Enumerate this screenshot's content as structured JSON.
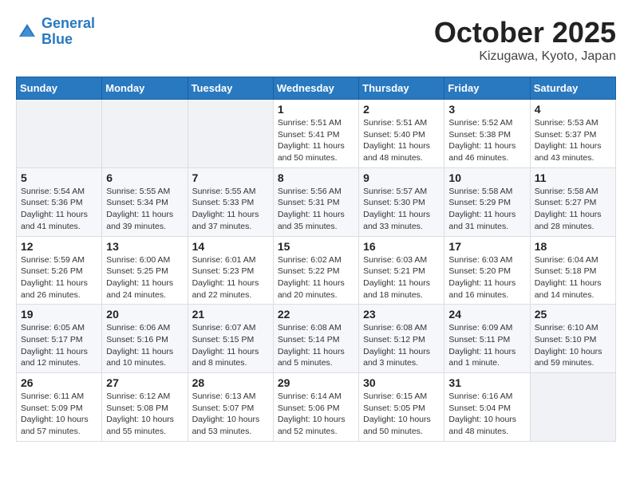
{
  "logo": {
    "line1": "General",
    "line2": "Blue"
  },
  "header": {
    "month": "October 2025",
    "location": "Kizugawa, Kyoto, Japan"
  },
  "weekdays": [
    "Sunday",
    "Monday",
    "Tuesday",
    "Wednesday",
    "Thursday",
    "Friday",
    "Saturday"
  ],
  "weeks": [
    [
      {
        "day": "",
        "info": ""
      },
      {
        "day": "",
        "info": ""
      },
      {
        "day": "",
        "info": ""
      },
      {
        "day": "1",
        "info": "Sunrise: 5:51 AM\nSunset: 5:41 PM\nDaylight: 11 hours\nand 50 minutes."
      },
      {
        "day": "2",
        "info": "Sunrise: 5:51 AM\nSunset: 5:40 PM\nDaylight: 11 hours\nand 48 minutes."
      },
      {
        "day": "3",
        "info": "Sunrise: 5:52 AM\nSunset: 5:38 PM\nDaylight: 11 hours\nand 46 minutes."
      },
      {
        "day": "4",
        "info": "Sunrise: 5:53 AM\nSunset: 5:37 PM\nDaylight: 11 hours\nand 43 minutes."
      }
    ],
    [
      {
        "day": "5",
        "info": "Sunrise: 5:54 AM\nSunset: 5:36 PM\nDaylight: 11 hours\nand 41 minutes."
      },
      {
        "day": "6",
        "info": "Sunrise: 5:55 AM\nSunset: 5:34 PM\nDaylight: 11 hours\nand 39 minutes."
      },
      {
        "day": "7",
        "info": "Sunrise: 5:55 AM\nSunset: 5:33 PM\nDaylight: 11 hours\nand 37 minutes."
      },
      {
        "day": "8",
        "info": "Sunrise: 5:56 AM\nSunset: 5:31 PM\nDaylight: 11 hours\nand 35 minutes."
      },
      {
        "day": "9",
        "info": "Sunrise: 5:57 AM\nSunset: 5:30 PM\nDaylight: 11 hours\nand 33 minutes."
      },
      {
        "day": "10",
        "info": "Sunrise: 5:58 AM\nSunset: 5:29 PM\nDaylight: 11 hours\nand 31 minutes."
      },
      {
        "day": "11",
        "info": "Sunrise: 5:58 AM\nSunset: 5:27 PM\nDaylight: 11 hours\nand 28 minutes."
      }
    ],
    [
      {
        "day": "12",
        "info": "Sunrise: 5:59 AM\nSunset: 5:26 PM\nDaylight: 11 hours\nand 26 minutes."
      },
      {
        "day": "13",
        "info": "Sunrise: 6:00 AM\nSunset: 5:25 PM\nDaylight: 11 hours\nand 24 minutes."
      },
      {
        "day": "14",
        "info": "Sunrise: 6:01 AM\nSunset: 5:23 PM\nDaylight: 11 hours\nand 22 minutes."
      },
      {
        "day": "15",
        "info": "Sunrise: 6:02 AM\nSunset: 5:22 PM\nDaylight: 11 hours\nand 20 minutes."
      },
      {
        "day": "16",
        "info": "Sunrise: 6:03 AM\nSunset: 5:21 PM\nDaylight: 11 hours\nand 18 minutes."
      },
      {
        "day": "17",
        "info": "Sunrise: 6:03 AM\nSunset: 5:20 PM\nDaylight: 11 hours\nand 16 minutes."
      },
      {
        "day": "18",
        "info": "Sunrise: 6:04 AM\nSunset: 5:18 PM\nDaylight: 11 hours\nand 14 minutes."
      }
    ],
    [
      {
        "day": "19",
        "info": "Sunrise: 6:05 AM\nSunset: 5:17 PM\nDaylight: 11 hours\nand 12 minutes."
      },
      {
        "day": "20",
        "info": "Sunrise: 6:06 AM\nSunset: 5:16 PM\nDaylight: 11 hours\nand 10 minutes."
      },
      {
        "day": "21",
        "info": "Sunrise: 6:07 AM\nSunset: 5:15 PM\nDaylight: 11 hours\nand 8 minutes."
      },
      {
        "day": "22",
        "info": "Sunrise: 6:08 AM\nSunset: 5:14 PM\nDaylight: 11 hours\nand 5 minutes."
      },
      {
        "day": "23",
        "info": "Sunrise: 6:08 AM\nSunset: 5:12 PM\nDaylight: 11 hours\nand 3 minutes."
      },
      {
        "day": "24",
        "info": "Sunrise: 6:09 AM\nSunset: 5:11 PM\nDaylight: 11 hours\nand 1 minute."
      },
      {
        "day": "25",
        "info": "Sunrise: 6:10 AM\nSunset: 5:10 PM\nDaylight: 10 hours\nand 59 minutes."
      }
    ],
    [
      {
        "day": "26",
        "info": "Sunrise: 6:11 AM\nSunset: 5:09 PM\nDaylight: 10 hours\nand 57 minutes."
      },
      {
        "day": "27",
        "info": "Sunrise: 6:12 AM\nSunset: 5:08 PM\nDaylight: 10 hours\nand 55 minutes."
      },
      {
        "day": "28",
        "info": "Sunrise: 6:13 AM\nSunset: 5:07 PM\nDaylight: 10 hours\nand 53 minutes."
      },
      {
        "day": "29",
        "info": "Sunrise: 6:14 AM\nSunset: 5:06 PM\nDaylight: 10 hours\nand 52 minutes."
      },
      {
        "day": "30",
        "info": "Sunrise: 6:15 AM\nSunset: 5:05 PM\nDaylight: 10 hours\nand 50 minutes."
      },
      {
        "day": "31",
        "info": "Sunrise: 6:16 AM\nSunset: 5:04 PM\nDaylight: 10 hours\nand 48 minutes."
      },
      {
        "day": "",
        "info": ""
      }
    ]
  ]
}
